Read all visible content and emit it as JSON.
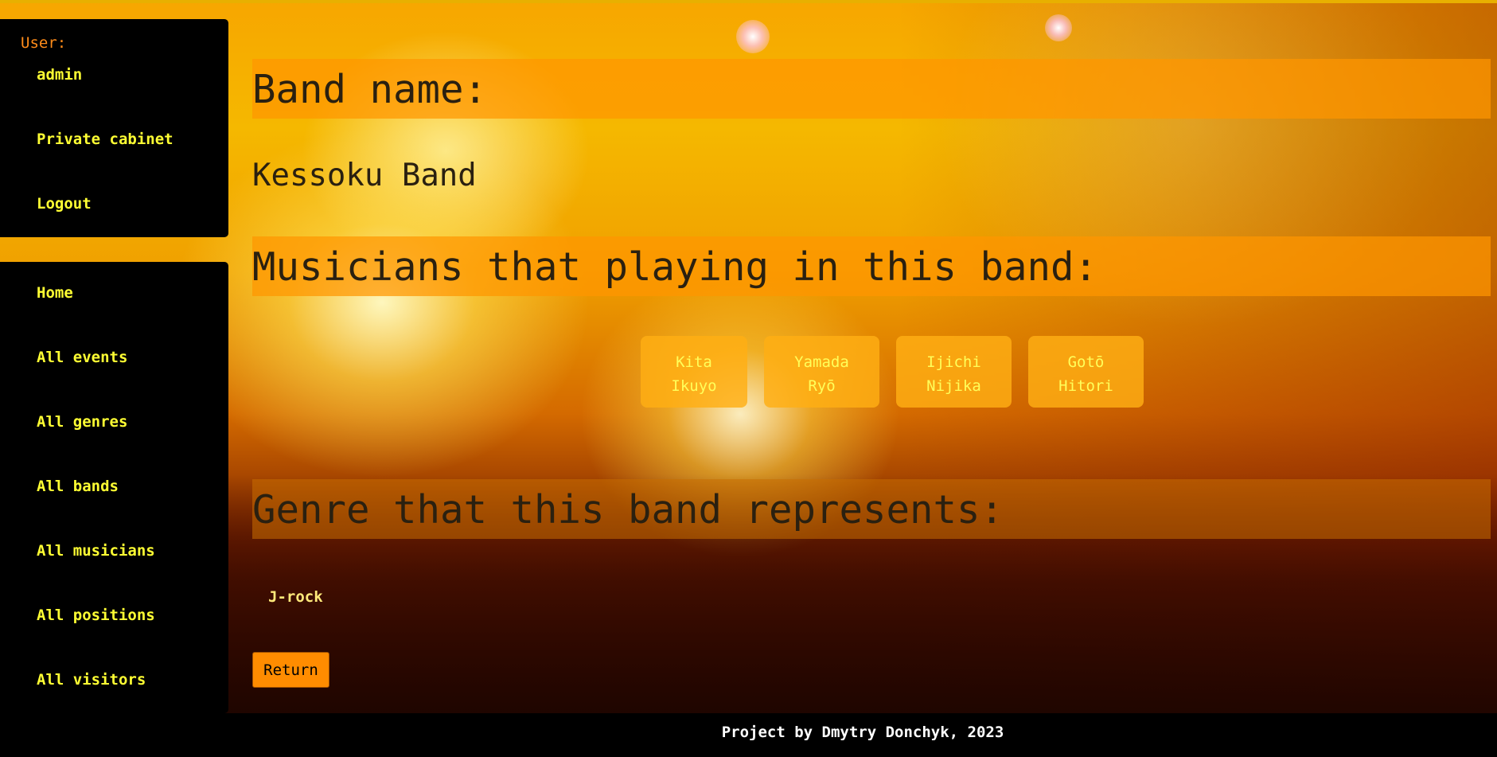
{
  "sidebar": {
    "user_label": "User:",
    "username": "admin",
    "private_cabinet": "Private cabinet",
    "logout": "Logout",
    "nav": [
      "Home",
      "All events",
      "All genres",
      "All bands",
      "All musicians",
      "All positions",
      "All visitors"
    ]
  },
  "main": {
    "band_heading": "Band name:",
    "band_name": "Kessoku Band",
    "musicians_heading": "Musicians that playing in this band:",
    "musicians": [
      {
        "first": "Kita",
        "last": "Ikuyo"
      },
      {
        "first": "Yamada",
        "last": "Ryō"
      },
      {
        "first": "Ijichi",
        "last": "Nijika"
      },
      {
        "first": "Gotō",
        "last": "Hitori"
      }
    ],
    "genre_heading": "Genre that this band represents:",
    "genre": "J-rock",
    "return_label": "Return"
  },
  "footer": {
    "text": "Project by Dmytry Donchyk, 2023"
  },
  "colors": {
    "sidebar_bg": "#000000",
    "sidebar_link": "#ffff33",
    "user_label": "#ff8c1a",
    "section_bar": "#ff9600",
    "button": "#ff8c00"
  }
}
